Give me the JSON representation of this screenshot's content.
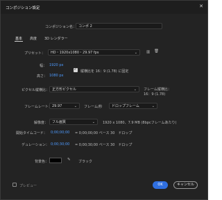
{
  "title": "コンポジション設定",
  "close_glyph": "✕",
  "comp_name": {
    "label": "コンポジション名：",
    "value": "コンポ 2"
  },
  "tabs": [
    {
      "label": "基本"
    },
    {
      "label": "高度"
    },
    {
      "label": "3D レンダラー"
    }
  ],
  "preset": {
    "label": "プリセット：",
    "value": "HD・1920x1080・29.97 fps"
  },
  "width": {
    "label": "幅：",
    "value": "1920 px"
  },
  "height": {
    "label": "高さ：",
    "value": "1080 px"
  },
  "lock_ratio": {
    "label": "縦横比を 16：9 (1.78) に固定",
    "checked": true
  },
  "pixel_aspect": {
    "label": "ピクセル縦横比：",
    "value": "正方形ピクセル"
  },
  "frame_aspect": {
    "label": "フレーム縦横比：",
    "value": "16：9 (1.78)"
  },
  "frame_rate": {
    "label": "フレームレート：",
    "value": "29.97",
    "unit": "フレーム/秒",
    "mode": "ドロップフレーム"
  },
  "resolution": {
    "label": "解像度：",
    "value": "フル画質",
    "info": "1920 x 1080、7.9 MB (8bpcフレームあたり)"
  },
  "start_timecode": {
    "label": "開始タイムコード：",
    "value": "0;00;00;00",
    "note": "= 0;00;00;00 ベース 30　ドロップ"
  },
  "duration": {
    "label": "デュレーション：",
    "value": "0;00;30;00",
    "note": "= 0;00;30;00 ベース 30　ドロップ"
  },
  "background": {
    "label": "背景色：",
    "color": "#000000",
    "name": "ブラック"
  },
  "preview": {
    "label": "プレビュー",
    "checked": false
  },
  "buttons": {
    "ok": "OK",
    "cancel": "キャンセル"
  },
  "icons": {
    "dropdown": "⌄",
    "eyedropper": "✎",
    "save_preset": "▥",
    "delete_preset": "🗑"
  },
  "colors": {
    "accent": "#2f6fe0",
    "link": "#4e9bff",
    "background": "#232323"
  }
}
